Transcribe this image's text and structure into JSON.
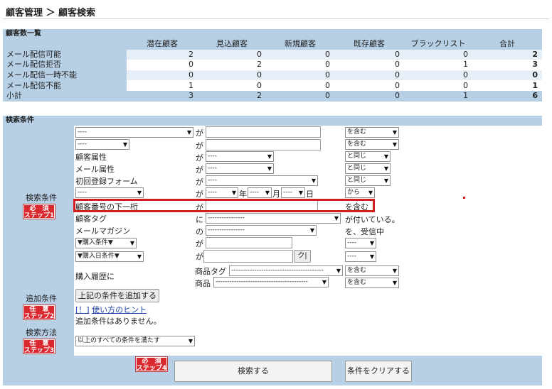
{
  "header": {
    "title": "顧客管理 ＞ 顧客検索"
  },
  "summary": {
    "section_title": "顧客数一覧",
    "columns": [
      "潜在顧客",
      "見込顧客",
      "新規顧客",
      "既存顧客",
      "ブラックリスト",
      "合計"
    ],
    "rows": [
      {
        "label": "メール配信可能",
        "values": [
          "2",
          "0",
          "0",
          "0",
          "0",
          "2"
        ]
      },
      {
        "label": "メール配信拒否",
        "values": [
          "0",
          "2",
          "0",
          "0",
          "1",
          "3"
        ]
      },
      {
        "label": "メール配信一時不能",
        "values": [
          "0",
          "0",
          "0",
          "0",
          "0",
          "0"
        ]
      },
      {
        "label": "メール配信不能",
        "values": [
          "1",
          "0",
          "0",
          "0",
          "0",
          "1"
        ]
      },
      {
        "label": "小計",
        "values": [
          "3",
          "2",
          "0",
          "0",
          "1",
          "6"
        ]
      }
    ]
  },
  "search": {
    "section_title": "検索条件",
    "labels": {
      "conditions": "検索条件",
      "add_conditions": "追加条件",
      "method": "検索方法"
    },
    "badges": {
      "step1": {
        "line1": "必　須",
        "line2": "ステップ1"
      },
      "step2": {
        "line1": "任　意",
        "line2": "ステップ2"
      },
      "step3": {
        "line1": "任　意",
        "line2": "ステップ3"
      },
      "step4": {
        "line1": "必　須",
        "line2": "ステップ4"
      }
    },
    "rows": {
      "r1": {
        "field": "----",
        "particle": "が",
        "op": "を含む"
      },
      "r2": {
        "field": "----",
        "particle": "が",
        "op": "を含む"
      },
      "r3": {
        "label": "顧客属性",
        "particle": "が",
        "value": "----",
        "op": "と同じ"
      },
      "r4": {
        "label": "メール属性",
        "particle": "が",
        "value": "----",
        "op": "と同じ"
      },
      "r5": {
        "label": "初回登録フォーム",
        "particle": "が",
        "value": "----",
        "op": "と同じ"
      },
      "r6": {
        "field": "----",
        "particle": "が",
        "year": "----",
        "year_unit": "年",
        "month": "----",
        "month_unit": "月",
        "day": "----",
        "day_unit": "日",
        "op": "から"
      },
      "r7": {
        "label": "顧客番号の下一桁",
        "particle": "が",
        "suffix": "を含む"
      },
      "r8": {
        "label": "顧客タグ",
        "particle": "に",
        "value": "----------------",
        "suffix": "が付いている。"
      },
      "r9": {
        "label": "メールマガジン",
        "particle": "の",
        "value": "----------------",
        "suffix": "を、受信中"
      },
      "r10": {
        "field": "▼購入条件▼",
        "particle": "が",
        "op": "----"
      },
      "r11": {
        "field": "▼購入日条件▼",
        "particle": "が",
        "calendar_button": "ク|",
        "op": "----"
      },
      "r12": {
        "label": "購入履歴に",
        "tag_label": "商品タグ",
        "tag_value": "----------------------------------------",
        "tag_op": "を含む",
        "product_label": "商品",
        "product_value": "----------------------------------------",
        "product_op": "を含む"
      }
    },
    "add_button": "上記の条件を追加する",
    "hint_prefix": "[！]",
    "hint_link": "使い方のヒント",
    "no_add_text": "追加条件はありません。",
    "method_value": "以上のすべての条件を満たす",
    "search_button": "検索する",
    "clear_button": "条件をクリアする"
  }
}
